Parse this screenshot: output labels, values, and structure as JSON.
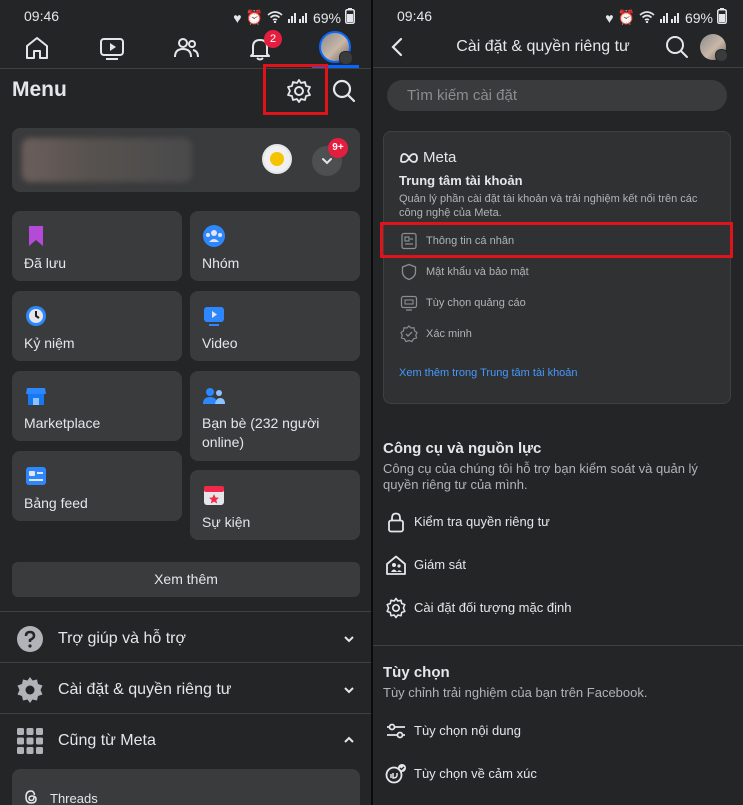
{
  "status": {
    "time": "09:46",
    "battery": "69%"
  },
  "left": {
    "notif_badge": "2",
    "menu_title": "Menu",
    "profile_badge": "9+",
    "tiles": {
      "saved": "Đã lưu",
      "groups": "Nhóm",
      "memories": "Kỷ niệm",
      "video": "Video",
      "marketplace": "Marketplace",
      "friends": "Bạn bè (232 người online)",
      "feed": "Bảng feed",
      "events": "Sự kiện"
    },
    "see_more": "Xem thêm",
    "help": "Trợ giúp và hỗ trợ",
    "settings": "Cài đặt & quyền riêng tư",
    "also_meta": "Cũng từ Meta",
    "threads": "Threads"
  },
  "right": {
    "header_title": "Cài đặt & quyền riêng tư",
    "search_placeholder": "Tìm kiếm cài đặt",
    "meta_logo": "Meta",
    "account_center_title": "Trung tâm tài khoản",
    "account_center_desc": "Quản lý phần cài đặt tài khoản và trải nghiệm kết nối trên các công nghệ của Meta.",
    "ac_items": [
      "Thông tin cá nhân",
      "Mật khẩu và bảo mật",
      "Tùy chọn quảng cáo",
      "Xác minh"
    ],
    "ac_link": "Xem thêm trong Trung tâm tài khoản",
    "tools_title": "Công cụ và nguồn lực",
    "tools_desc": "Công cụ của chúng tôi hỗ trợ bạn kiểm soát và quản lý quyền riêng tư của mình.",
    "tools_items": [
      "Kiểm tra quyền riêng tư",
      "Giám sát",
      "Cài đặt đối tượng mặc định"
    ],
    "prefs_title": "Tùy chọn",
    "prefs_desc": "Tùy chỉnh trải nghiệm của bạn trên Facebook.",
    "prefs_items": [
      "Tùy chọn nội dung",
      "Tùy chọn về cảm xúc"
    ]
  },
  "colors": {
    "accent": "#0866ff",
    "link": "#4599ff",
    "badge": "#e41e3f",
    "highlight": "#e0121a"
  }
}
